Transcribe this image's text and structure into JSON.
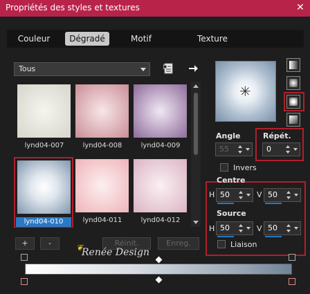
{
  "window": {
    "title": "Propriétés des styles et textures",
    "close": "✕"
  },
  "tabs": [
    {
      "label": "Couleur",
      "active": false
    },
    {
      "label": "Dégradé",
      "active": true
    },
    {
      "label": "Motif",
      "active": false
    },
    {
      "label": "Texture",
      "active": false
    }
  ],
  "filter": {
    "value": "Tous"
  },
  "icons": {
    "menu": "list-icon",
    "next": "arrow-right-icon"
  },
  "thumbnails": [
    {
      "label": "lynd04-007",
      "selected": false,
      "colors": [
        "#f3f2ea",
        "#d7d6cc"
      ]
    },
    {
      "label": "lynd04-008",
      "selected": false,
      "colors": [
        "#f5d9dc",
        "#c98e96"
      ]
    },
    {
      "label": "lynd04-009",
      "selected": false,
      "colors": [
        "#e9dced",
        "#8d6b9b"
      ]
    },
    {
      "label": "lynd04-010",
      "selected": true,
      "colors": [
        "#ffffff",
        "#7f97ae"
      ]
    },
    {
      "label": "lynd04-011",
      "selected": false,
      "colors": [
        "#fbe3e5",
        "#eeb4ba"
      ]
    },
    {
      "label": "lynd04-012",
      "selected": false,
      "colors": [
        "#f6e3ea",
        "#dbb4c4"
      ]
    }
  ],
  "list_buttons": {
    "add": "+",
    "remove": "-",
    "reset": "Réinit.",
    "save": "Enreg."
  },
  "watermark": "Renée Design",
  "style": {
    "angle_label": "Angle",
    "angle_value": "55",
    "repeat_label": "Répét.",
    "repeat_value": "0",
    "invert_label": "Invers",
    "center_label": "Centre",
    "center_h_label": "H",
    "center_h": "50",
    "center_v_label": "V",
    "center_v": "50",
    "source_label": "Source",
    "source_h_label": "H",
    "source_h": "50",
    "source_v_label": "V",
    "source_v": "50",
    "link_label": "Liaison"
  },
  "gradient": {
    "colors": [
      "#ffffff",
      "#d8dde3",
      "#9aa7b5",
      "#6f8399"
    ]
  }
}
